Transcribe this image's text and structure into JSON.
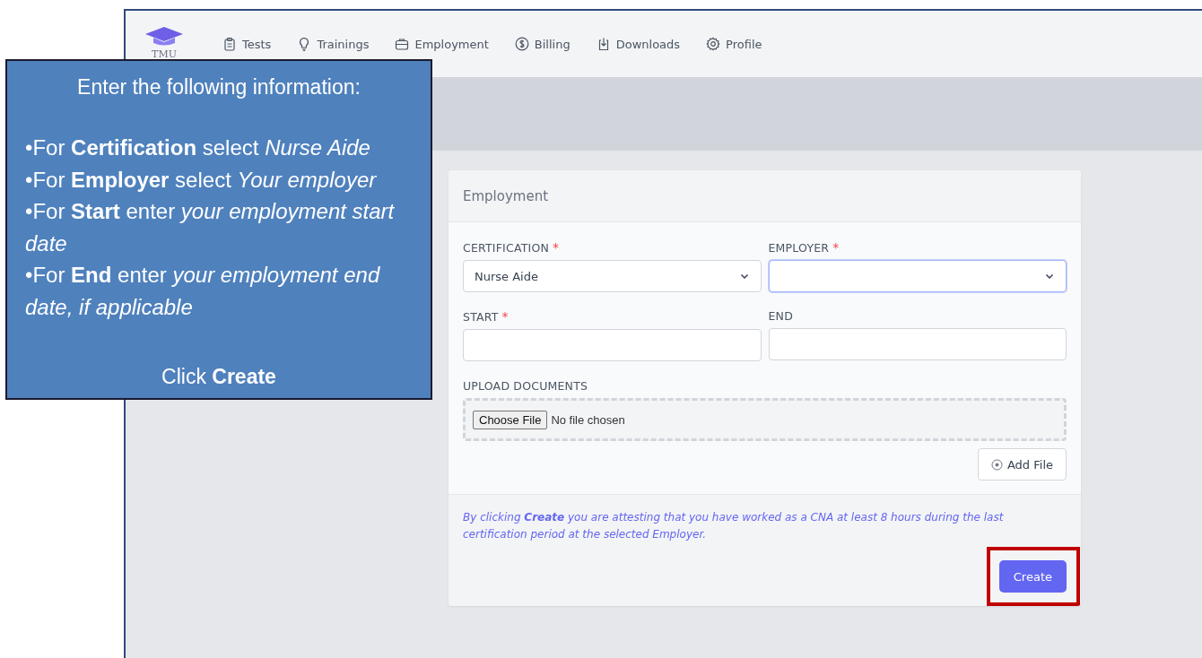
{
  "logo": {
    "text": "TMU"
  },
  "nav": [
    {
      "label": "Tests"
    },
    {
      "label": "Trainings"
    },
    {
      "label": "Employment"
    },
    {
      "label": "Billing"
    },
    {
      "label": "Downloads"
    },
    {
      "label": "Profile"
    }
  ],
  "card": {
    "title": "Employment",
    "fields": [
      {
        "label": "CERTIFICATION",
        "required_mark": "*",
        "kind": "select",
        "value": "Nurse Aide",
        "focused": false
      },
      {
        "label": "EMPLOYER",
        "required_mark": "*",
        "kind": "select",
        "focused": true
      },
      {
        "label": "START",
        "required_mark": "*",
        "kind": "text",
        "focused": false
      },
      {
        "label": "END",
        "kind": "text",
        "focused": false
      }
    ],
    "upload": {
      "label": "UPLOAD DOCUMENTS",
      "button": "Choose File",
      "status": "No file chosen"
    },
    "add_file": "Add File",
    "notice": "By clicking **Create** you are attesting that you have worked as a CNA at least 8 hours during the last certification period at the selected Employer.",
    "create": {
      "label": "Create",
      "highlighted": true
    }
  },
  "callout": {
    "heading": "Enter the following information:",
    "bullets": [
      "•For **Certification** select *Nurse Aide*",
      "•For **Employer** select *Your employer*",
      "•For **Start** enter *your employment start date*",
      "•For **End** enter *your employment end date, if applicable*"
    ],
    "footer": "Click **Create**"
  }
}
